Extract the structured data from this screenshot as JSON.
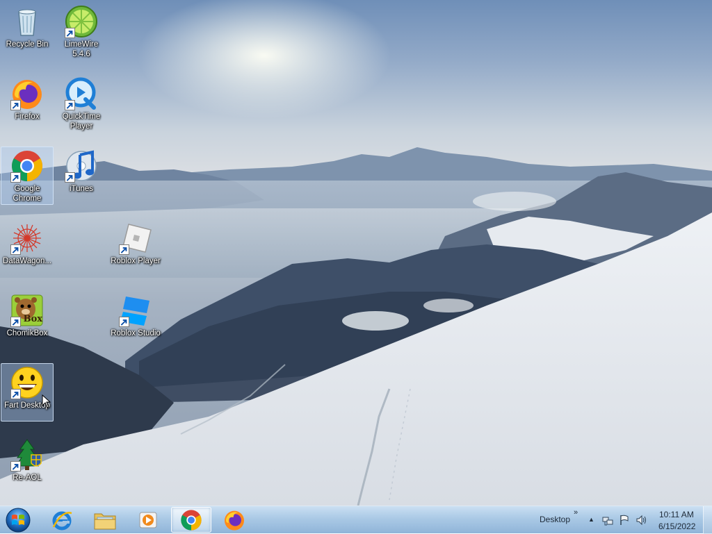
{
  "desktop": {
    "icons": [
      {
        "label": "Recycle Bin",
        "icon": "recycle-bin-icon"
      },
      {
        "label": "LimeWire 5.4.6",
        "icon": "limewire-icon"
      },
      {
        "label": "Firefox",
        "icon": "firefox-icon"
      },
      {
        "label": "QuickTime Player",
        "icon": "quicktime-icon"
      },
      {
        "label": "Google Chrome",
        "icon": "chrome-icon"
      },
      {
        "label": "iTunes",
        "icon": "itunes-icon"
      },
      {
        "label": "DataWagon...",
        "icon": "datawagon-icon"
      },
      {
        "label": "Roblox Player",
        "icon": "roblox-player-icon"
      },
      {
        "label": "ChomikBox",
        "icon": "chomikbox-icon"
      },
      {
        "label": "Roblox Studio",
        "icon": "roblox-studio-icon"
      },
      {
        "label": "Fart Desktop",
        "icon": "smiley-icon"
      },
      {
        "label": "Re-AOL",
        "icon": "re-aol-icon"
      }
    ],
    "chomikbox_badge": "Box"
  },
  "taskbar": {
    "pinned": [
      {
        "icon": "internet-explorer-icon"
      },
      {
        "icon": "file-explorer-icon"
      },
      {
        "icon": "media-player-icon"
      },
      {
        "icon": "chrome-icon",
        "active": true
      },
      {
        "icon": "firefox-icon"
      }
    ],
    "toolbar_label": "Desktop",
    "toolbar_chevron": "»",
    "tray_expand": "▲",
    "time": "10:11 AM",
    "date": "6/15/2022"
  },
  "colors": {
    "taskbar": "#a5c6e4",
    "selection": "#aac8eb",
    "chrome_red": "#db4437",
    "chrome_green": "#0f9d58",
    "chrome_yellow": "#f4b400",
    "chrome_blue": "#4285f4"
  }
}
